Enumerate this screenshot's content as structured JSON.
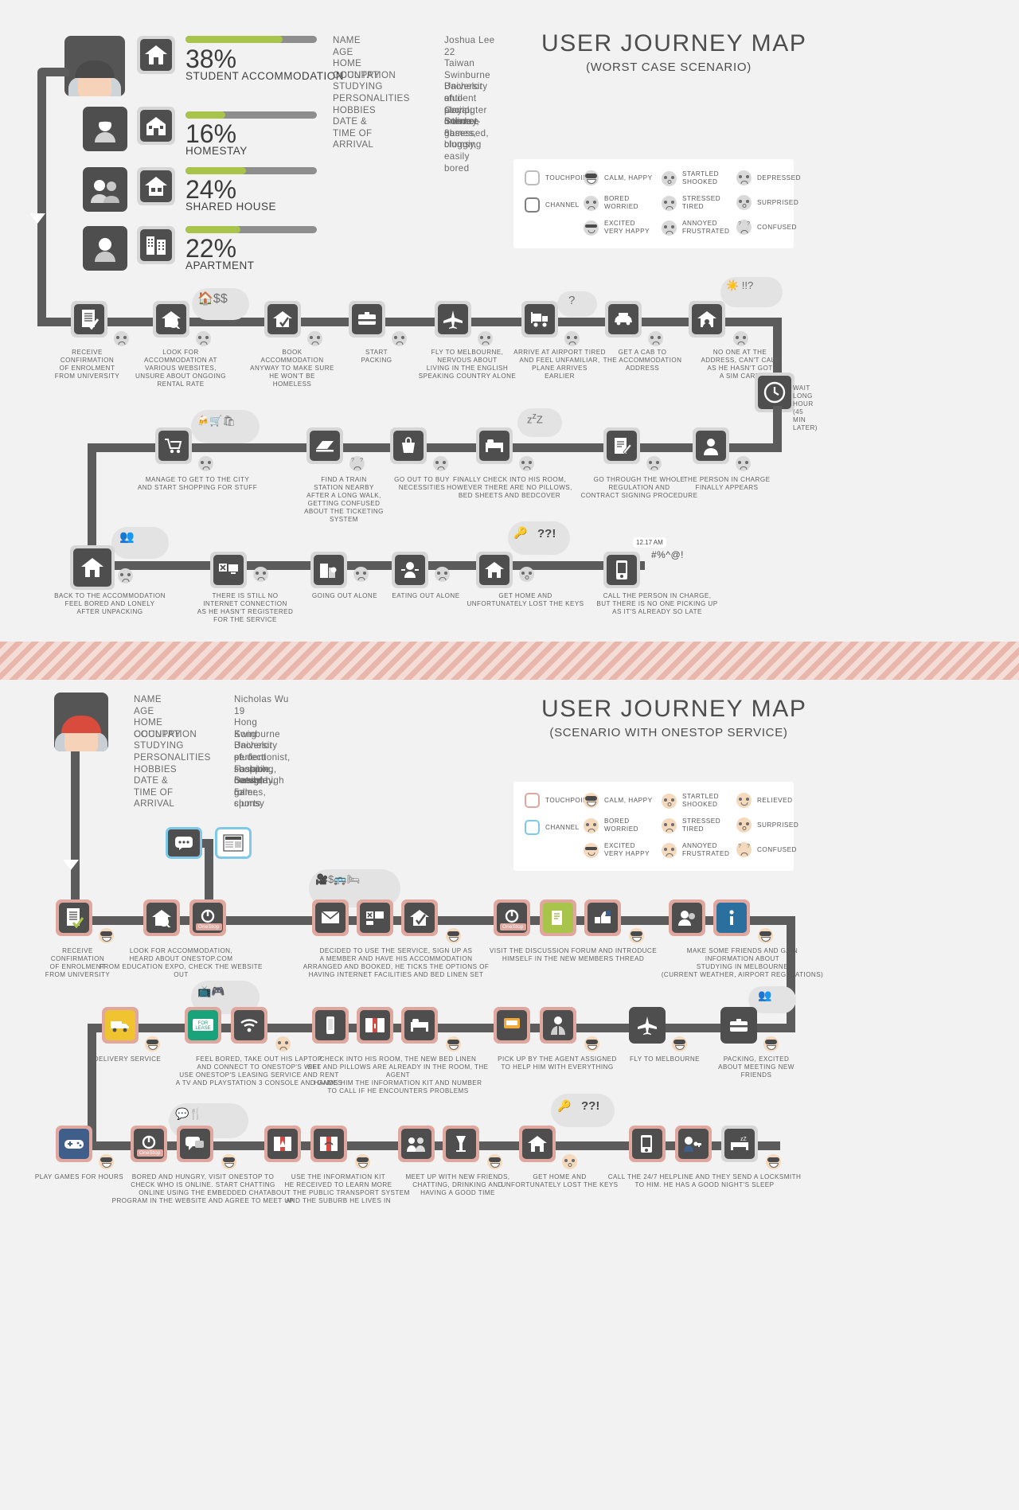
{
  "worst": {
    "title_main": "USER JOURNEY MAP",
    "title_sub": "(WORST CASE SCENARIO)",
    "stats": [
      {
        "pct": "38%",
        "label": "STUDENT ACCOMMODATION",
        "value": 38,
        "icon": "house-icon",
        "avatar": "male-student-avatar"
      },
      {
        "pct": "16%",
        "label": "HOMESTAY",
        "value": 16,
        "icon": "home-building-icon",
        "avatar": "female-avatar"
      },
      {
        "pct": "24%",
        "label": "SHARED HOUSE",
        "value": 24,
        "icon": "shared-house-icon",
        "avatar": "two-people-avatar"
      },
      {
        "pct": "22%",
        "label": "APARTMENT",
        "value": 22,
        "icon": "apartment-icon",
        "avatar": "person-avatar"
      }
    ],
    "persona": {
      "keys": [
        "NAME",
        "AGE",
        "HOME COUNTRY",
        "OCCUPATION",
        "STUDYING",
        "PERSONALITIES",
        "HOBBIES",
        "DATE & TIME OF ARRIVAL"
      ],
      "values": [
        "Joshua Lee",
        "22",
        "Taiwan",
        "Swinburne University student",
        "Bachelor of Computer Science",
        "anti-social, internet-obsessed, clumsy, easily bored",
        "playing online games, blogging",
        "Sunday, 8am"
      ]
    },
    "legend": {
      "keys": [
        {
          "label": "TOUCHPOINT",
          "icon": "rounded-square-outline-icon"
        },
        {
          "label": "CHANNEL",
          "icon": "rounded-square-outline-dark-icon"
        }
      ],
      "moods": [
        {
          "label": "CALM, HAPPY",
          "icon": "sunglasses-grin-face-icon"
        },
        {
          "label": "BORED\nWORRIED",
          "icon": "frowning-face-icon"
        },
        {
          "label": "EXCITED\nVERY HAPPY",
          "icon": "excited-face-icon"
        },
        {
          "label": "STARTLED\nSHOOKED",
          "icon": "startled-face-icon"
        },
        {
          "label": "STRESSED\nTIRED",
          "icon": "stressed-face-icon"
        },
        {
          "label": "ANNOYED\nFRUSTRATED",
          "icon": "annoyed-face-icon"
        },
        {
          "label": "DEPRESSED",
          "icon": "depressed-face-icon"
        },
        {
          "label": "SURPRISED",
          "icon": "surprised-face-icon"
        },
        {
          "label": "CONFUSED",
          "icon": "confused-face-icon"
        }
      ]
    },
    "steps_row1": [
      {
        "caption": "RECEIVE\nCONFIRMATION\nOF ENROLMENT\nFROM UNIVERSITY",
        "icon": "document-check-icon",
        "mood": "neutral"
      },
      {
        "caption": "LOOK FOR\nACCOMMODATION AT\nVARIOUS WEBSITES,\nUNSURE ABOUT ONGOING\nRENTAL RATE",
        "icon": "house-search-icon",
        "mood": "worried",
        "cloud": "house-dollar-icon"
      },
      {
        "caption": "BOOK\nACCOMMODATION\nANYWAY TO MAKE SURE\nHE WON'T BE\nHOMELESS",
        "icon": "house-check-icon",
        "mood": "worried"
      },
      {
        "caption": "START\nPACKING",
        "icon": "suitcase-icon",
        "mood": "neutral"
      },
      {
        "caption": "FLY TO MELBOURNE,\nNERVOUS ABOUT\nLIVING IN THE ENGLISH\nSPEAKING COUNTRY ALONE",
        "icon": "airplane-icon",
        "mood": "worried"
      },
      {
        "caption": "ARRIVE AT AIRPORT TIRED\nAND FEEL UNFAMILIAR,\nPLANE ARRIVES\nEARLIER",
        "icon": "luggage-trolley-icon",
        "mood": "tired",
        "cloud": "question-icon"
      },
      {
        "caption": "GET A CAB TO\nTHE ACCOMMODATION\nADDRESS",
        "icon": "taxi-icon",
        "mood": "neutral"
      },
      {
        "caption": "NO ONE AT THE\nADDRESS, CAN'T CALL\nAS HE HASN'T GOT\nA SIM CARD",
        "icon": "house-person-icon",
        "mood": "annoyed",
        "cloud": "sun-alarm-icon"
      },
      {
        "caption": "WAIT\nLONG HOUR\n(45 MIN LATER)",
        "icon": "clock-icon",
        "mood": "none"
      }
    ],
    "steps_row2": [
      {
        "caption": "MANAGE TO GET TO THE CITY\nAND START SHOPPING FOR STUFF",
        "icon": "shopping-trolley-icon",
        "mood": "neutral",
        "cloud": "shopping-items-icon"
      },
      {
        "caption": "FIND A TRAIN\nSTATION NEARBY\nAFTER A LONG WALK,\nGETTING CONFUSED\nABOUT THE TICKETING\nSYSTEM",
        "icon": "train-icon",
        "mood": "confused"
      },
      {
        "caption": "GO OUT TO BUY\nNECESSITIES",
        "icon": "shopping-bag-icon",
        "mood": "neutral"
      },
      {
        "caption": "FINALLY CHECK INTO HIS ROOM,\nHOWEVER THERE ARE NO PILLOWS,\nBED SHEETS AND BEDCOVER",
        "icon": "bed-icon",
        "mood": "annoyed",
        "cloud": "sleep-zzz-icon"
      },
      {
        "caption": "GO THROUGH THE WHOLE\nREGULATION AND\nCONTRACT SIGNING PROCEDURE",
        "icon": "contract-pen-icon",
        "mood": "tired"
      },
      {
        "caption": "THE PERSON IN CHARGE\nFINALLY APPEARS",
        "icon": "person-icon",
        "mood": "neutral"
      }
    ],
    "steps_row3": [
      {
        "caption": "BACK TO THE ACCOMMODATION\nFEEL BORED AND LONELY\nAFTER UNPACKING",
        "icon": "house-icon",
        "mood": "sad",
        "cloud": "people-group-icon"
      },
      {
        "caption": "THERE IS STILL NO\nINTERNET CONNECTION\nAS HE HASN'T REGISTERED\nFOR THE SERVICE",
        "icon": "no-wifi-monitor-icon",
        "mood": "annoyed"
      },
      {
        "caption": "GOING OUT ALONE",
        "icon": "buildings-person-icon",
        "mood": "sad"
      },
      {
        "caption": "EATING OUT ALONE",
        "icon": "dining-person-icon",
        "mood": "sad"
      },
      {
        "caption": "GET HOME AND\nUNFORTUNATELY LOST THE KEYS",
        "icon": "house-lost-keys-icon",
        "mood": "shocked",
        "cloud": "keys-question-icon"
      },
      {
        "caption": "CALL THE PERSON IN CHARGE,\nBUT THERE IS NO ONE PICKING UP\nAS IT'S ALREADY SO LATE",
        "icon": "mobile-phone-icon",
        "mood": "angry",
        "bubble": "12.17 AM",
        "scribble": "#%^@!"
      }
    ]
  },
  "onestop": {
    "title_main": "USER JOURNEY MAP",
    "title_sub": "(SCENARIO WITH ONESTOP SERVICE)",
    "persona": {
      "keys": [
        "NAME",
        "AGE",
        "HOME COUNTRY",
        "OCCUPATION",
        "STUDYING",
        "PERSONALITIES",
        "HOBBIES",
        "DATE & TIME OF ARRIVAL"
      ],
      "values": [
        "Nicholas Wu",
        "19",
        "Hong Kong",
        "Swinburne University student",
        "Bachelor of Fashion Design",
        "perfectionist, sociable, needy, high roller, clumsy",
        "shopping, console games, sports",
        "Saturday, 5am"
      ]
    },
    "legend": {
      "keys": [
        {
          "label": "TOUCHPOINT",
          "icon": "rounded-square-pink-outline-icon"
        },
        {
          "label": "CHANNEL",
          "icon": "rounded-square-blue-outline-icon"
        }
      ],
      "moods": [
        {
          "label": "CALM, HAPPY",
          "icon": "sunglasses-grin-face-icon"
        },
        {
          "label": "BORED\nWORRIED",
          "icon": "frowning-face-icon"
        },
        {
          "label": "EXCITED\nVERY HAPPY",
          "icon": "excited-face-icon"
        },
        {
          "label": "STARTLED\nSHOOKED",
          "icon": "startled-face-icon"
        },
        {
          "label": "STRESSED\nTIRED",
          "icon": "stressed-face-icon"
        },
        {
          "label": "ANNOYED\nFRUSTRATED",
          "icon": "annoyed-face-icon"
        },
        {
          "label": "RELIEVED",
          "icon": "relieved-face-icon"
        },
        {
          "label": "SURPRISED",
          "icon": "surprised-face-icon"
        },
        {
          "label": "CONFUSED",
          "icon": "confused-face-icon"
        }
      ]
    },
    "steps_row1": [
      {
        "caption": "RECEIVE\nCONFIRMATION\nOF ENROLMENT\nFROM UNIVERSITY",
        "icon": "document-check-icon",
        "mood": "happy"
      },
      {
        "caption": "LOOK FOR ACCOMMODATION,\nHEARD ABOUT ONESTOP.COM\nFROM EDUCATION EXPO, CHECK THE WEBSITE OUT",
        "icon": "house-search-icon",
        "mood": "happy",
        "channel": "chat-news-icon"
      },
      {
        "caption": "DECIDED TO USE THE SERVICE, SIGN UP AS\nA MEMBER AND HAVE HIS ACCOMMODATION\nARRANGED AND BOOKED, HE TICKS THE OPTIONS OF\nHAVING INTERNET FACILITIES AND BED LINEN SET",
        "icon": "signup-form-icon",
        "mood": "happy",
        "cloud": "media-wifi-bus-bed-icon"
      },
      {
        "caption": "VISIT THE DISCUSSION FORUM AND INTRODUCE\nHIMSELF IN THE NEW MEMBERS THREAD",
        "icon": "forum-icon",
        "mood": "happy"
      },
      {
        "caption": "MAKE SOME FRIENDS AND GAIN\nINFORMATION ABOUT\nSTUDYING IN MELBOURNE\n(CURRENT WEATHER, AIRPORT REGULATIONS)",
        "icon": "friends-info-icon",
        "mood": "happy"
      }
    ],
    "steps_row2": [
      {
        "caption": "DELIVERY SERVICE",
        "icon": "delivery-truck-icon",
        "mood": "happy"
      },
      {
        "caption": "FEEL BORED, TAKE OUT HIS LAPTOP\nAND CONNECT TO ONESTOP'S WIFI.\nUSE ONESTOP'S LEASING SERVICE AND RENT\nA TV AND PLAYSTATION 3 CONSOLE AND GAMES",
        "icon": "for-lease-wifi-icon",
        "mood": "happy",
        "cloud": "tv-gamepad-icon"
      },
      {
        "caption": "CHECK INTO HIS ROOM, THE NEW BED LINEN\nSET AND PILLOWS ARE ALREADY IN THE ROOM, THE AGENT\nHANDS HIM THE INFORMATION KIT AND NUMBER\nTO CALL IF HE ENCOUNTERS PROBLEMS",
        "icon": "room-key-bed-icon",
        "mood": "happy"
      },
      {
        "caption": "PICK UP BY THE AGENT ASSIGNED\nTO HELP HIM WITH EVERYTHING",
        "icon": "bus-agent-icon",
        "mood": "happy"
      },
      {
        "caption": "FLY TO MELBOURNE",
        "icon": "airplane-icon",
        "mood": "happy"
      },
      {
        "caption": "PACKING, EXCITED\nABOUT MEETING NEW\nFRIENDS",
        "icon": "suitcase-friends-icon",
        "mood": "excited"
      }
    ],
    "steps_row3": [
      {
        "caption": "PLAY GAMES FOR HOURS",
        "icon": "gamepad-icon",
        "mood": "happy"
      },
      {
        "caption": "BORED AND HUNGRY, VISIT ONESTOP TO\nCHECK WHO IS ONLINE. START CHATTING\nONLINE USING THE EMBEDDED CHAT\nPROGRAM IN THE WEBSITE AND AGREE TO MEET UP",
        "icon": "onestop-chat-icon",
        "mood": "happy",
        "cloud": "chat-food-icon"
      },
      {
        "caption": "USE THE INFORMATION KIT\nHE RECEIVED TO LEARN MORE\nABOUT THE PUBLIC TRANSPORT SYSTEM\nAND THE SUBURB HE LIVES IN",
        "icon": "transport-map-icon",
        "mood": "happy"
      },
      {
        "caption": "MEET UP WITH NEW FRIENDS,\nCHATTING, DRINKING AND\nHAVING A GOOD TIME",
        "icon": "friends-drinks-icon",
        "mood": "happy"
      },
      {
        "caption": "GET HOME AND\nUNFORTUNATELY LOST THE KEYS",
        "icon": "house-lost-keys-icon",
        "mood": "shocked",
        "cloud": "keys-question-icon"
      },
      {
        "caption": "CALL THE 24/7 HELPLINE AND THEY SEND A LOCKSMITH\nTO HIM. HE HAS A GOOD NIGHT'S SLEEP",
        "icon": "helpline-locksmith-sleep-icon",
        "mood": "relieved"
      }
    ]
  },
  "colors": {
    "accent_green": "#a9c44b",
    "pink": "#dfa79d",
    "dark": "#4e4e4e",
    "bg": "#f2f2f2"
  }
}
